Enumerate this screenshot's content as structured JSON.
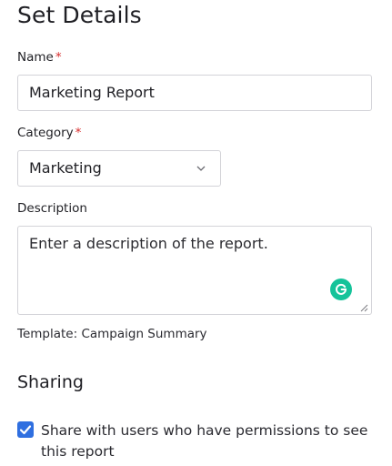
{
  "header": {
    "title": "Set Details"
  },
  "form": {
    "name": {
      "label": "Name",
      "required_mark": "*",
      "value": "Marketing Report"
    },
    "category": {
      "label": "Category",
      "required_mark": "*",
      "selected": "Marketing",
      "icon": "chevron-down-icon"
    },
    "description": {
      "label": "Description",
      "placeholder": "Enter a description of the report.",
      "value": "",
      "assist_icon": "grammarly-icon"
    },
    "template": "Template: Campaign Summary"
  },
  "sharing": {
    "title": "Sharing",
    "share_checkbox": {
      "checked": true,
      "label": "Share with users who have permissions to see this report"
    }
  },
  "colors": {
    "accent": "#2f6fe0",
    "required": "#d72c2c",
    "grammarly": "#15c39a",
    "border": "#d3d3d8"
  }
}
